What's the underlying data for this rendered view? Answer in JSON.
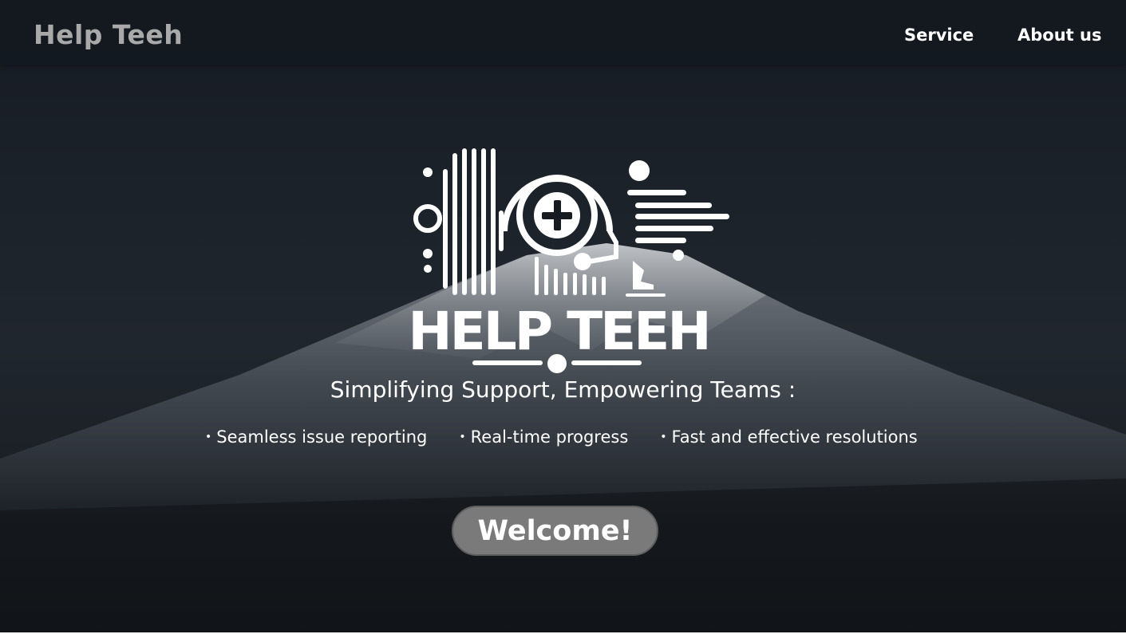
{
  "navbar": {
    "brand": "Help Teeh",
    "links": [
      {
        "label": "Service"
      },
      {
        "label": "About us"
      }
    ]
  },
  "hero": {
    "logo_text": "HELP TEEH",
    "tagline": "Simplifying Support, Empowering Teams :",
    "features": [
      "Seamless issue reporting",
      "Real-time progress",
      "Fast and effective resolutions"
    ],
    "cta_label": "Welcome!"
  },
  "colors": {
    "navbar_bg": "#14191f",
    "brand_text": "#a9a9a9",
    "button_bg": "#7a7a7a",
    "text": "#ffffff"
  }
}
